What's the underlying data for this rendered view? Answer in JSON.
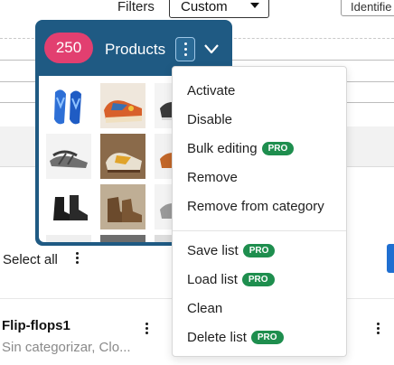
{
  "toolbar": {
    "filters_label": "Filters",
    "custom_select_value": "Custom",
    "identifier_text": "Identifie"
  },
  "panel": {
    "count": "250",
    "title": "Products"
  },
  "menu": {
    "items": [
      {
        "label": "Activate",
        "pro": ""
      },
      {
        "label": "Disable",
        "pro": ""
      },
      {
        "label": "Bulk editing",
        "pro": "PRO"
      },
      {
        "label": "Remove",
        "pro": ""
      },
      {
        "label": "Remove from category",
        "pro": ""
      },
      {
        "label": "Save list",
        "pro": "PRO"
      },
      {
        "label": "Load list",
        "pro": "PRO"
      },
      {
        "label": "Clean",
        "pro": ""
      },
      {
        "label": "Delete list",
        "pro": "PRO"
      }
    ]
  },
  "list": {
    "select_all": "Select all"
  },
  "card": {
    "title": "Flip-flops1",
    "subtitle": "Sin categorizar, Clo..."
  },
  "colors": {
    "panel_bg": "#1f5a83",
    "badge": "#e23f70",
    "pro_badge": "#1e8e4e",
    "primary_button": "#1f6fd1"
  }
}
